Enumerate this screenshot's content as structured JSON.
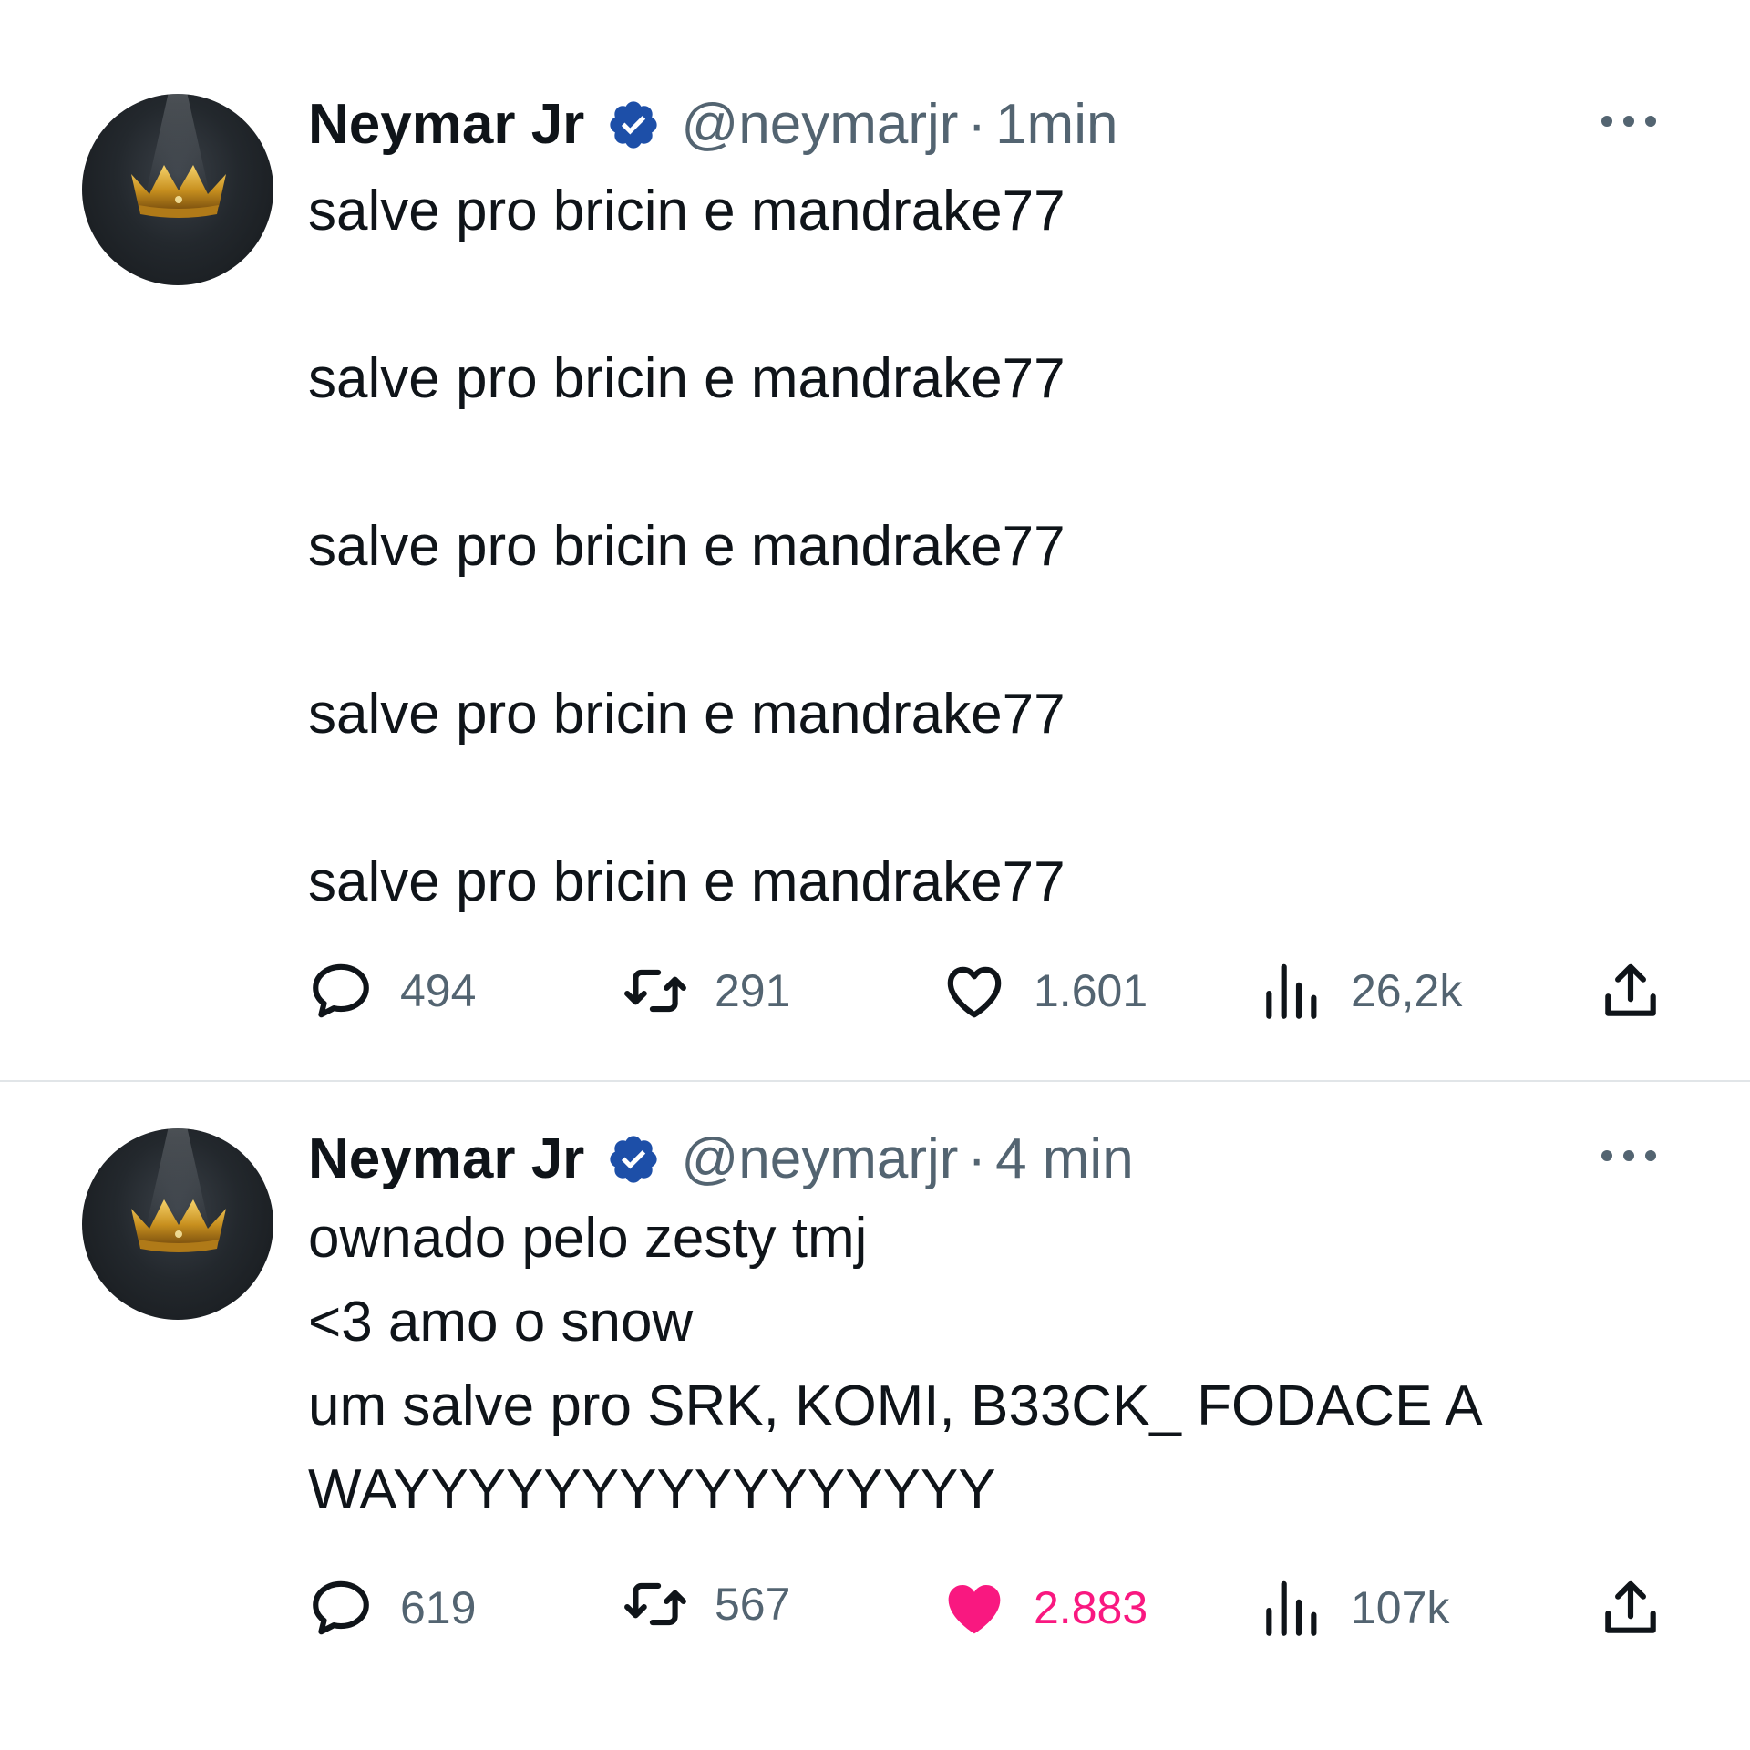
{
  "colors": {
    "text_primary": "#0f1419",
    "text_secondary": "#536471",
    "verified_blue": "#1d4fa8",
    "like_active": "#f91880",
    "divider": "#e1e5e8"
  },
  "tweets": [
    {
      "author_name": "Neymar Jr",
      "handle": "@neymarjr",
      "separator": "·",
      "time": "1min",
      "lines": [
        "salve pro bricin e mandrake77",
        "",
        "salve pro bricin e mandrake77",
        "",
        "salve pro bricin e mandrake77",
        "",
        "salve pro bricin e mandrake77",
        "",
        "salve pro bricin e mandrake77"
      ],
      "stats": {
        "replies": "494",
        "retweets": "291",
        "likes": "1.601",
        "views": "26,2k"
      },
      "liked": false
    },
    {
      "author_name": "Neymar Jr",
      "handle": "@neymarjr",
      "separator": "·",
      "time": "4 min",
      "lines": [
        "ownado pelo zesty tmj",
        "<3 amo o snow",
        "um salve pro SRK, KOMI, B33CK_ FODACE A",
        "WAYYYYYYYYYYYYYYYY"
      ],
      "stats": {
        "replies": "619",
        "retweets": "567",
        "likes": "2.883",
        "views": "107k"
      },
      "liked": true
    }
  ],
  "icons": {
    "avatar": "crown-avatar",
    "verified": "verified-badge-icon",
    "more": "more-dots-icon",
    "reply": "reply-icon",
    "retweet": "retweet-icon",
    "like": "heart-icon",
    "views": "views-bar-icon",
    "share": "share-icon"
  }
}
